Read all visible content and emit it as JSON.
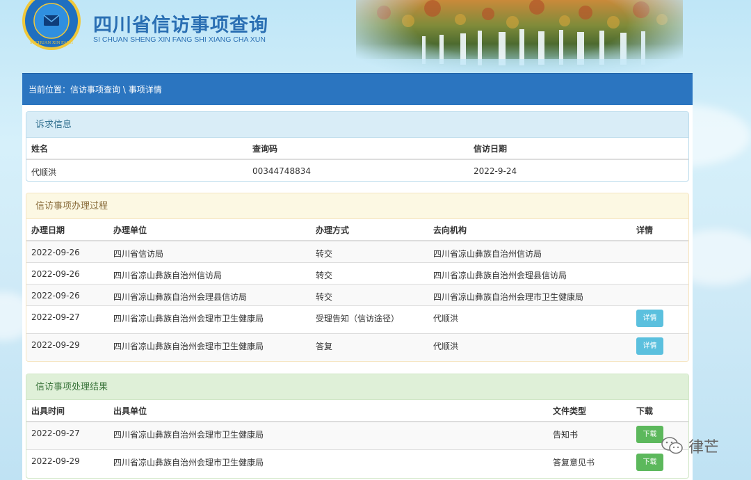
{
  "header": {
    "title": "四川省信访事项查询",
    "subtitle": "SI CHUAN SHENG XIN FANG SHI XIANG CHA XUN",
    "logo_text": "SI CHUAN XIN FANG"
  },
  "breadcrumb": {
    "label": "当前位置：",
    "path": "信访事项查询 \\ 事项详情"
  },
  "petition": {
    "heading": "诉求信息",
    "columns": [
      "姓名",
      "查询码",
      "信访日期"
    ],
    "row": [
      "代顺洪",
      "00344748834",
      "2022-9-24"
    ]
  },
  "process": {
    "heading": "信访事项办理过程",
    "columns": [
      "办理日期",
      "办理单位",
      "办理方式",
      "去向机构",
      "详情"
    ],
    "rows": [
      {
        "date": "2022-09-26",
        "unit": "四川省信访局",
        "method": "转交",
        "dest": "四川省凉山彝族自治州信访局",
        "detail": ""
      },
      {
        "date": "2022-09-26",
        "unit": "四川省凉山彝族自治州信访局",
        "method": "转交",
        "dest": "四川省凉山彝族自治州会理县信访局",
        "detail": ""
      },
      {
        "date": "2022-09-26",
        "unit": "四川省凉山彝族自治州会理县信访局",
        "method": "转交",
        "dest": "四川省凉山彝族自治州会理市卫生健康局",
        "detail": ""
      },
      {
        "date": "2022-09-27",
        "unit": "四川省凉山彝族自治州会理市卫生健康局",
        "method": "受理告知（信访途径）",
        "dest": "代顺洪",
        "detail": "详情"
      },
      {
        "date": "2022-09-29",
        "unit": "四川省凉山彝族自治州会理市卫生健康局",
        "method": "答复",
        "dest": "代顺洪",
        "detail": "详情"
      }
    ]
  },
  "result": {
    "heading": "信访事项处理结果",
    "columns": [
      "出具时间",
      "出具单位",
      "文件类型",
      "下载"
    ],
    "rows": [
      {
        "time": "2022-09-27",
        "unit": "四川省凉山彝族自治州会理市卫生健康局",
        "type": "告知书",
        "download": "下载"
      },
      {
        "time": "2022-09-29",
        "unit": "四川省凉山彝族自治州会理市卫生健康局",
        "type": "答复意见书",
        "download": "下载"
      }
    ]
  },
  "watermark": {
    "text": "律芒",
    "icon": "wechat-icon"
  },
  "colors": {
    "breadcrumb_bg": "#2b75c0",
    "info_btn": "#5bc0de",
    "success_btn": "#5cb85c",
    "title": "#2a6fb3"
  }
}
